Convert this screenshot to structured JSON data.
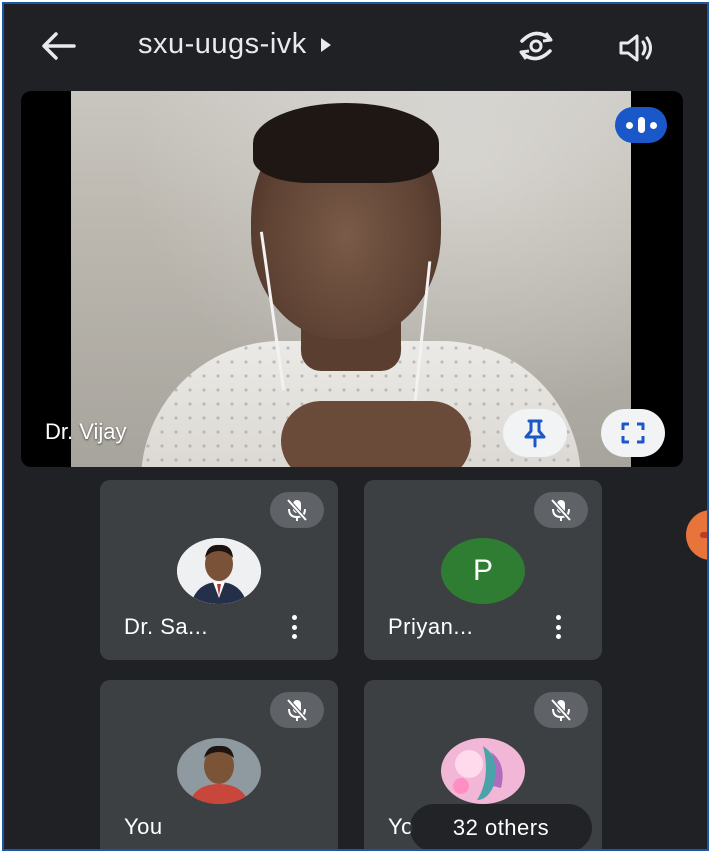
{
  "header": {
    "meeting_code": "sxu-uugs-ivk",
    "back_icon": "arrow-left-icon",
    "switch_camera_icon": "switch-camera-icon",
    "speaker_icon": "speaker-icon"
  },
  "main_tile": {
    "participant_name": "Dr. Vijay",
    "audio_indicator_icon": "speaking-indicator-icon",
    "pin_icon": "pin-icon",
    "fullscreen_icon": "fullscreen-icon"
  },
  "participants": [
    {
      "name": "Dr. Sa...",
      "avatar": "photo",
      "muted": true
    },
    {
      "name": "Priyan...",
      "avatar": "letter",
      "initial": "P",
      "muted": true
    },
    {
      "name": "You",
      "avatar": "photo",
      "muted": true
    },
    {
      "name": "Yo",
      "avatar": "photo",
      "muted": true
    }
  ],
  "others_count": "32 others",
  "colors": {
    "background": "#202124",
    "tile": "#3c4043",
    "accent_blue": "#1a57c8",
    "letter_avatar_green": "#2e7d32"
  }
}
